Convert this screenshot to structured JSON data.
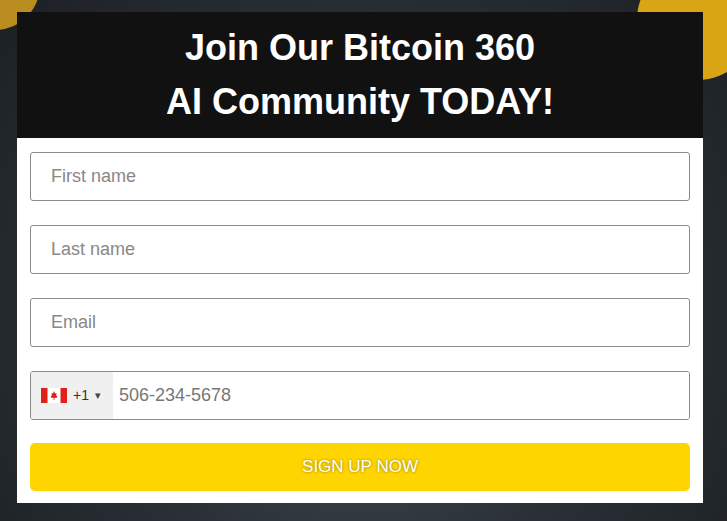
{
  "header": {
    "lines": [
      "Join Our Bitcoin 360",
      "AI Community TODAY!"
    ]
  },
  "fields": [
    {
      "placeholder": "First name"
    },
    {
      "placeholder": "Last name"
    },
    {
      "placeholder": "Email"
    }
  ],
  "phone": {
    "code": "+1",
    "arrow": "▾",
    "placeholder": "506-234-5678"
  },
  "button": {
    "label": "SIGN UP NOW"
  }
}
